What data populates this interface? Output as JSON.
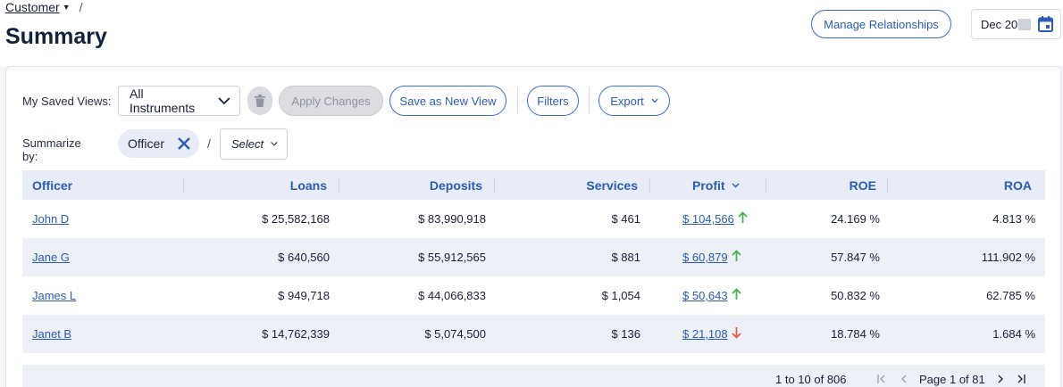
{
  "breadcrumb": {
    "link": "Customer",
    "separator": "/"
  },
  "page_title": "Summary",
  "header": {
    "manage_label": "Manage Relationships",
    "date_value": "Dec 20"
  },
  "toolbar": {
    "saved_views_label": "My Saved Views:",
    "saved_view_selected": "All Instruments",
    "apply_label": "Apply Changes",
    "save_new_label": "Save as New View",
    "filters_label": "Filters",
    "export_label": "Export"
  },
  "summarize": {
    "label": "Summarize by:",
    "chip": "Officer",
    "separator": "/",
    "select_placeholder": "Select"
  },
  "table": {
    "columns": [
      "Officer",
      "Loans",
      "Deposits",
      "Services",
      "Profit",
      "ROE",
      "ROA"
    ],
    "rows": [
      {
        "officer": "John D",
        "loans": "$ 25,582,168",
        "deposits": "$ 83,990,918",
        "services": "$ 461",
        "profit": "$ 104,566",
        "trend": "up",
        "roe": "24.169 %",
        "roa": "4.813 %"
      },
      {
        "officer": "Jane G",
        "loans": "$ 640,560",
        "deposits": "$ 55,912,565",
        "services": "$ 881",
        "profit": "$ 60,879",
        "trend": "up",
        "roe": "57.847 %",
        "roa": "111.902 %"
      },
      {
        "officer": "James L",
        "loans": "$ 949,718",
        "deposits": "$ 44,066,833",
        "services": "$ 1,054",
        "profit": "$ 50,643",
        "trend": "up",
        "roe": "50.832 %",
        "roa": "62.785 %"
      },
      {
        "officer": "Janet B",
        "loans": "$ 14,762,339",
        "deposits": "$ 5,074,500",
        "services": "$ 136",
        "profit": "$ 21,108",
        "trend": "down",
        "roe": "18.784 %",
        "roa": "1.684 %"
      }
    ]
  },
  "pagination": {
    "count_text": "1 to 10 of 806",
    "page_text": "Page 1 of 81"
  },
  "colors": {
    "accent": "#2d5bb5",
    "trend_up": "#4caf50",
    "trend_down": "#e05a4f",
    "header_bg": "#e8ecf8",
    "row_alt": "#eef0f8"
  },
  "icons": [
    "chevron-down-icon",
    "trash-icon",
    "calendar-icon",
    "close-icon",
    "arrow-up-icon",
    "arrow-down-icon",
    "first-page-icon",
    "prev-page-icon",
    "next-page-icon",
    "last-page-icon"
  ]
}
